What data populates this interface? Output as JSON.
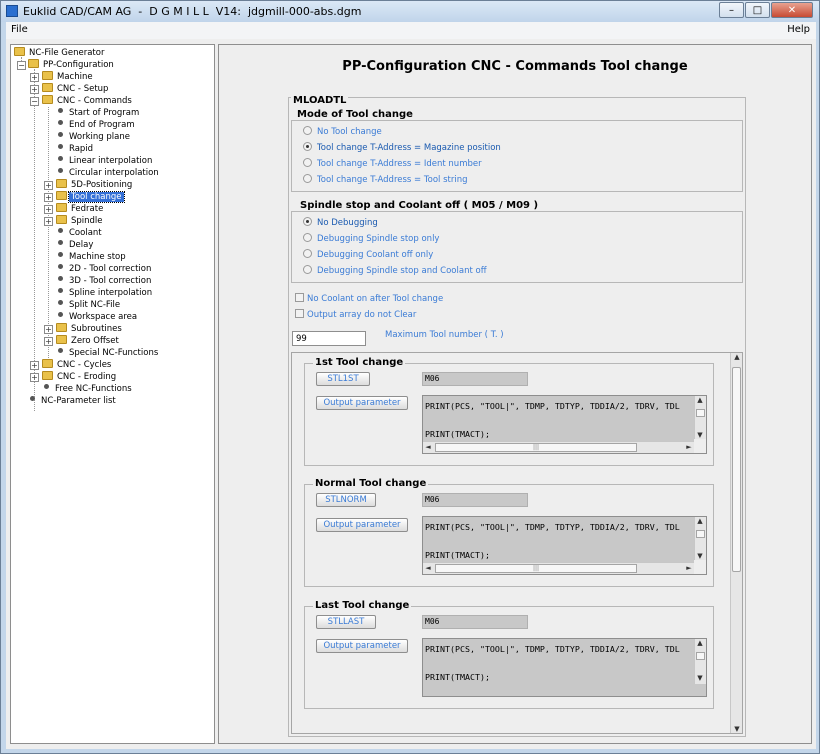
{
  "window": {
    "title": "Euklid CAD/CAM AG  -  D G M I L L  V14:  jdgmill-000-abs.dgm"
  },
  "menu": {
    "file": "File",
    "help": "Help"
  },
  "tree": {
    "root": "NC-File Generator",
    "pp": "PP-Configuration",
    "machine": "Machine",
    "cnc_setup": "CNC - Setup",
    "cnc_commands": "CNC - Commands",
    "commands": [
      "Start of Program",
      "End of Program",
      "Working plane",
      "Rapid",
      "Linear interpolation",
      "Circular interpolation"
    ],
    "positioning": "5D-Positioning",
    "tool_change": "Tool change",
    "fedrate": "Fedrate",
    "spindle": "Spindle",
    "commands2": [
      "Coolant",
      "Delay",
      "Machine stop",
      "2D - Tool correction",
      "3D - Tool correction",
      "Spline interpolation",
      "Split NC-File",
      "Workspace area"
    ],
    "subroutines": "Subroutines",
    "zero_offset": "Zero Offset",
    "special": "Special NC-Functions",
    "cnc_cycles": "CNC - Cycles",
    "cnc_eroding": "CNC - Eroding",
    "free_nc": "Free NC-Functions",
    "nc_param": "NC-Parameter list"
  },
  "main": {
    "title": "PP-Configuration CNC - Commands Tool change",
    "section": "MLOADTL",
    "mode_group": "Mode of Tool change",
    "mode_options": [
      "No Tool change",
      "Tool change T-Address = Magazine position",
      "Tool change T-Address = Ident number",
      "Tool change T-Address = Tool string"
    ],
    "mode_selected": 1,
    "spindle_group": "Spindle stop and Coolant off ( M05 / M09 )",
    "spindle_options": [
      "No Debugging",
      "Debugging Spindle stop only",
      "Debugging Coolant off only",
      "Debugging Spindle stop and Coolant off"
    ],
    "spindle_selected": 0,
    "chk_no_coolant": "No Coolant on after Tool change",
    "chk_output_array": "Output array do not Clear",
    "max_tool_value": "99",
    "max_tool_label": "Maximum Tool number ( T. )",
    "groups": [
      {
        "label": "1st Tool change",
        "button": "STL1ST",
        "code": "M06",
        "param_button": "Output parameter",
        "line1": "PRINT(PCS, \"TOOL|\", TDMP, TDTYP, TDDIA/2, TDRV, TDL",
        "line2": "PRINT(TMACT);"
      },
      {
        "label": "Normal Tool change",
        "button": "STLNORM",
        "code": "M06",
        "param_button": "Output parameter",
        "line1": "PRINT(PCS, \"TOOL|\", TDMP, TDTYP, TDDIA/2, TDRV, TDL",
        "line2": "PRINT(TMACT);"
      },
      {
        "label": "Last Tool change",
        "button": "STLLAST",
        "code": "M06",
        "param_button": "Output parameter",
        "line1": "PRINT(PCS, \"TOOL|\", TDMP, TDTYP, TDDIA/2, TDRV, TDL",
        "line2": "PRINT(TMACT);"
      }
    ]
  }
}
